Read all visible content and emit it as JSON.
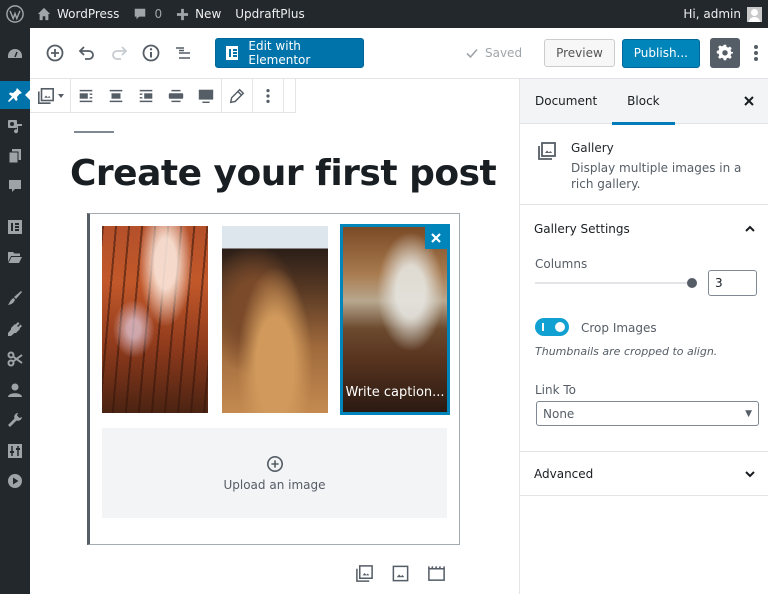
{
  "admin_bar": {
    "site_name": "WordPress",
    "comments_count": "0",
    "new_label": "New",
    "plugin_label": "UpdraftPlus",
    "greeting": "Hi, admin"
  },
  "admin_menu": {
    "items": [
      "Dashboard",
      "Posts",
      "Media",
      "Pages",
      "Comments",
      "Elementor",
      "Templates",
      "Appearance",
      "Plugins",
      "Snippets",
      "Users",
      "Tools",
      "Settings",
      "Video"
    ],
    "active": "Posts"
  },
  "editor_header": {
    "elementor_label": "Edit with Elementor",
    "saved_label": "Saved",
    "preview_label": "Preview",
    "publish_label": "Publish..."
  },
  "post": {
    "title": "Create your first post",
    "gallery": {
      "images": [
        {
          "alt": "Autumn forest with orange leaves"
        },
        {
          "alt": "Hillside of autumn trees"
        },
        {
          "alt": "Path through autumn park",
          "caption_placeholder": "Write caption...",
          "selected": true
        }
      ],
      "upload_label": "Upload an image"
    }
  },
  "sidebar": {
    "tabs": [
      {
        "label": "Document",
        "active": false
      },
      {
        "label": "Block",
        "active": true
      }
    ],
    "block": {
      "name": "Gallery",
      "description": "Display multiple images in a rich gallery."
    },
    "gallery_settings": {
      "title": "Gallery Settings",
      "columns_label": "Columns",
      "columns_value": "3",
      "columns_range": {
        "min": 1,
        "max": 3,
        "value": 3
      },
      "crop_label": "Crop Images",
      "crop_enabled": true,
      "crop_help": "Thumbnails are cropped to align.",
      "link_to_label": "Link To",
      "link_to_value": "None"
    },
    "advanced_title": "Advanced"
  },
  "colors": {
    "accent": "#0085ba",
    "admin_bar_bg": "#23282d",
    "toggle_on": "#11a0d2"
  }
}
